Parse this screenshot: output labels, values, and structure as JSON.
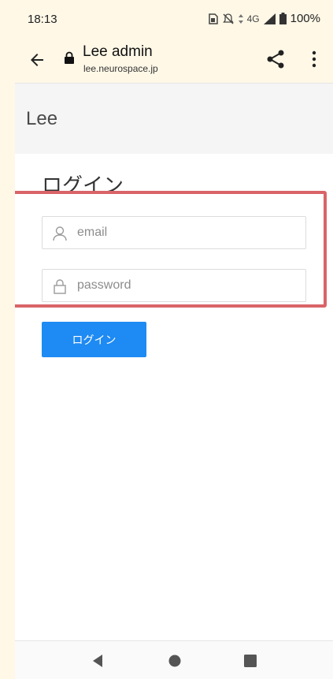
{
  "status_bar": {
    "time": "18:13",
    "network": "4G",
    "battery": "100%"
  },
  "browser": {
    "title": "Lee admin",
    "url": "lee.neurospace.jp"
  },
  "app": {
    "header_title": "Lee"
  },
  "login": {
    "heading": "ログイン",
    "email_placeholder": "email",
    "password_placeholder": "password",
    "submit_label": "ログイン"
  },
  "colors": {
    "accent": "#1e8af3",
    "highlight": "#d96468",
    "chrome_background": "#fff8e7"
  }
}
